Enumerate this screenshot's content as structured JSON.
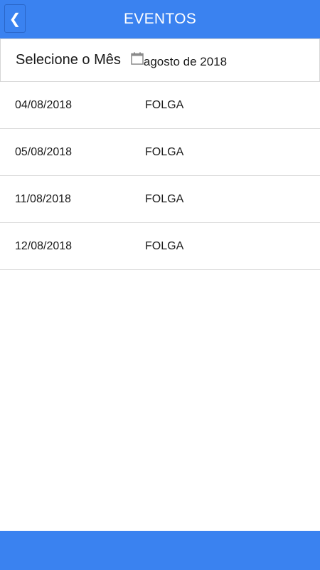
{
  "header": {
    "back_label": "❮",
    "title": "EVENTOS"
  },
  "month_selector": {
    "label": "Selecione o Mês",
    "icon": "calendar-icon",
    "value": "agosto de 2018"
  },
  "events": [
    {
      "date": "04/08/2018",
      "description": "FOLGA"
    },
    {
      "date": "05/08/2018",
      "description": "FOLGA"
    },
    {
      "date": "11/08/2018",
      "description": "FOLGA"
    },
    {
      "date": "12/08/2018",
      "description": "FOLGA"
    }
  ],
  "colors": {
    "primary": "#3a82f0",
    "divider": "#d9d9d9",
    "text": "#1a1a1a",
    "icon": "#8a8a8a"
  }
}
